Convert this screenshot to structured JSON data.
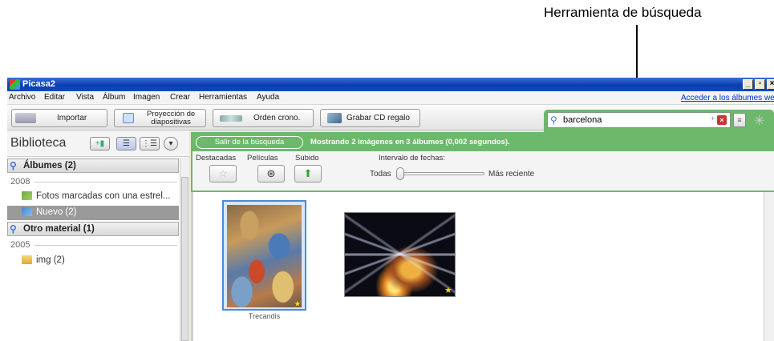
{
  "annotation": {
    "label": "Herramienta de búsqueda"
  },
  "window": {
    "title": "Picasa2"
  },
  "menu": {
    "items": [
      "Archivo",
      "Editar",
      "Vista",
      "Álbum",
      "Imagen",
      "Crear",
      "Herramientas",
      "Ayuda"
    ],
    "link": "Acceder a los álbumes we"
  },
  "toolbar": {
    "import": "Importar",
    "slideshow_line1": "Proyección de",
    "slideshow_line2": "diapositivas",
    "timeline": "Orden crono.",
    "giftcd": "Grabar CD regalo"
  },
  "search": {
    "value": "barcelona"
  },
  "library": {
    "title": "Biblioteca",
    "albums_section": "Álbumes (2)",
    "year_2008": "2008",
    "album_starred": "Fotos marcadas con una estrel...",
    "album_nuevo": "Nuevo (2)",
    "other_section": "Otro material (1)",
    "year_2005": "2005",
    "folder_img": "img (2)"
  },
  "filter": {
    "exit_search": "Salir de la búsqueda",
    "status": "Mostrando 2 imágenes en 3 álbumes (0,002 segundos).",
    "starred": "Destacadas",
    "movies": "Películas",
    "uploaded": "Subido",
    "date_range": "Intervalo de fechas:",
    "range_all": "Todas",
    "range_recent": "Más reciente"
  },
  "photos": [
    {
      "caption": "Trecandis",
      "starred": true,
      "selected": true
    },
    {
      "caption": "",
      "starred": true,
      "selected": false
    }
  ],
  "colors": {
    "search_green": "#6cb96c",
    "selection_blue": "#4a8ad8",
    "titlebar_blue": "#0a3fb0"
  }
}
